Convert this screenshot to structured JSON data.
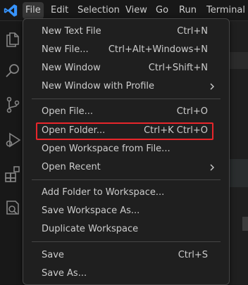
{
  "menubar": {
    "items": [
      {
        "label": "File"
      },
      {
        "label": "Edit"
      },
      {
        "label": "Selection"
      },
      {
        "label": "View"
      },
      {
        "label": "Go"
      },
      {
        "label": "Run"
      },
      {
        "label": "Terminal"
      }
    ]
  },
  "file_menu": {
    "groups": [
      [
        {
          "label": "New Text File",
          "shortcut": "Ctrl+N"
        },
        {
          "label": "New File...",
          "shortcut": "Ctrl+Alt+Windows+N"
        },
        {
          "label": "New Window",
          "shortcut": "Ctrl+Shift+N"
        },
        {
          "label": "New Window with Profile",
          "submenu": true
        }
      ],
      [
        {
          "label": "Open File...",
          "shortcut": "Ctrl+O"
        },
        {
          "label": "Open Folder...",
          "shortcut": "Ctrl+K Ctrl+O",
          "highlighted": true
        },
        {
          "label": "Open Workspace from File..."
        },
        {
          "label": "Open Recent",
          "submenu": true
        }
      ],
      [
        {
          "label": "Add Folder to Workspace..."
        },
        {
          "label": "Save Workspace As..."
        },
        {
          "label": "Duplicate Workspace"
        }
      ],
      [
        {
          "label": "Save",
          "shortcut": "Ctrl+S"
        },
        {
          "label": "Save As..."
        }
      ]
    ]
  },
  "colors": {
    "highlight_box": "#e8262b",
    "logo": "#3794ff"
  }
}
